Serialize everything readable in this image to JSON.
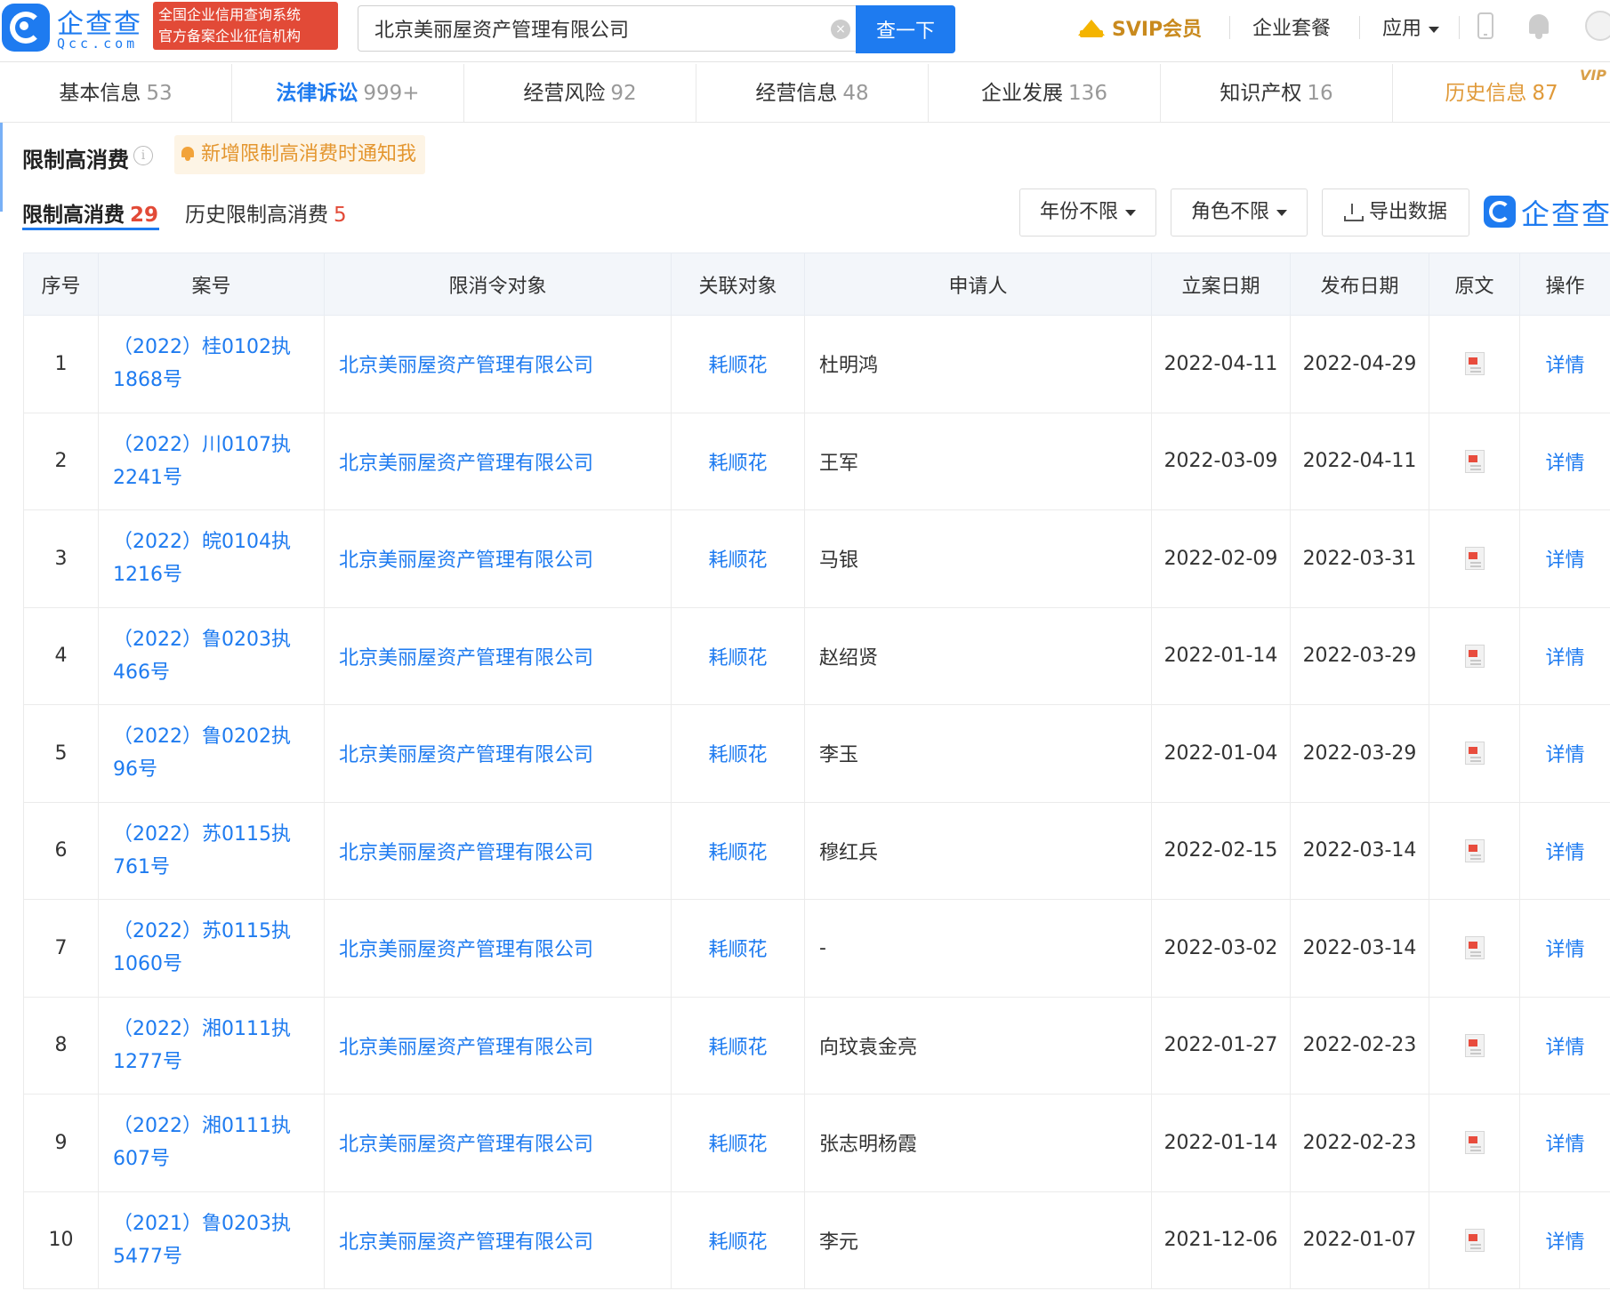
{
  "header": {
    "logo_cn": "企查查",
    "logo_en": "Qcc.com",
    "badge_line1": "全国企业信用查询系统",
    "badge_line2": "官方备案企业征信机构",
    "search_value": "北京美丽屋资产管理有限公司",
    "search_button": "查一下",
    "vip_label": "SVIP会员",
    "nav_package": "企业套餐",
    "nav_apps": "应用"
  },
  "tabs": [
    {
      "label": "基本信息",
      "count": "53"
    },
    {
      "label": "法律诉讼",
      "count": "999+"
    },
    {
      "label": "经营风险",
      "count": "92"
    },
    {
      "label": "经营信息",
      "count": "48"
    },
    {
      "label": "企业发展",
      "count": "136"
    },
    {
      "label": "知识产权",
      "count": "16"
    },
    {
      "label": "历史信息",
      "count": "87",
      "tag": "VIP"
    }
  ],
  "section": {
    "title": "限制高消费",
    "info_glyph": "i",
    "notify": "新增限制高消费时通知我",
    "subtab_active_label": "限制高消费",
    "subtab_active_count": "29",
    "subtab_history_label": "历史限制高消费",
    "subtab_history_count": "5",
    "filter_year": "年份不限",
    "filter_role": "角色不限",
    "export": "导出数据",
    "brand": "企查查"
  },
  "table": {
    "headers": [
      "序号",
      "案号",
      "限消令对象",
      "关联对象",
      "申请人",
      "立案日期",
      "发布日期",
      "原文",
      "操作"
    ],
    "rows": [
      {
        "no": "1",
        "case": "（2022）桂0102执1868号",
        "target": "北京美丽屋资产管理有限公司",
        "related": "耗顺花",
        "applicant": "杜明鸿",
        "filed": "2022-04-11",
        "published": "2022-04-29",
        "action": "详情"
      },
      {
        "no": "2",
        "case": "（2022）川0107执2241号",
        "target": "北京美丽屋资产管理有限公司",
        "related": "耗顺花",
        "applicant": "王军",
        "filed": "2022-03-09",
        "published": "2022-04-11",
        "action": "详情"
      },
      {
        "no": "3",
        "case": "（2022）皖0104执1216号",
        "target": "北京美丽屋资产管理有限公司",
        "related": "耗顺花",
        "applicant": "马银",
        "filed": "2022-02-09",
        "published": "2022-03-31",
        "action": "详情"
      },
      {
        "no": "4",
        "case": "（2022）鲁0203执466号",
        "target": "北京美丽屋资产管理有限公司",
        "related": "耗顺花",
        "applicant": "赵绍贤",
        "filed": "2022-01-14",
        "published": "2022-03-29",
        "action": "详情"
      },
      {
        "no": "5",
        "case": "（2022）鲁0202执96号",
        "target": "北京美丽屋资产管理有限公司",
        "related": "耗顺花",
        "applicant": "李玉",
        "filed": "2022-01-04",
        "published": "2022-03-29",
        "action": "详情"
      },
      {
        "no": "6",
        "case": "（2022）苏0115执761号",
        "target": "北京美丽屋资产管理有限公司",
        "related": "耗顺花",
        "applicant": "穆红兵",
        "filed": "2022-02-15",
        "published": "2022-03-14",
        "action": "详情"
      },
      {
        "no": "7",
        "case": "（2022）苏0115执1060号",
        "target": "北京美丽屋资产管理有限公司",
        "related": "耗顺花",
        "applicant": "-",
        "filed": "2022-03-02",
        "published": "2022-03-14",
        "action": "详情"
      },
      {
        "no": "8",
        "case": "（2022）湘0111执1277号",
        "target": "北京美丽屋资产管理有限公司",
        "related": "耗顺花",
        "applicant": "向玟袁金亮",
        "filed": "2022-01-27",
        "published": "2022-02-23",
        "action": "详情"
      },
      {
        "no": "9",
        "case": "（2022）湘0111执607号",
        "target": "北京美丽屋资产管理有限公司",
        "related": "耗顺花",
        "applicant": "张志明杨霞",
        "filed": "2022-01-14",
        "published": "2022-02-23",
        "action": "详情"
      },
      {
        "no": "10",
        "case": "（2021）鲁0203执5477号",
        "target": "北京美丽屋资产管理有限公司",
        "related": "耗顺花",
        "applicant": "李元",
        "filed": "2021-12-06",
        "published": "2022-01-07",
        "action": "详情"
      }
    ]
  },
  "icons": {
    "logo": "qcc-logo-icon",
    "clear": "clear-icon",
    "crown": "crown-icon",
    "phone": "phone-icon",
    "bell": "bell-icon",
    "info": "info-icon",
    "download": "download-icon",
    "pdf": "pdf-icon"
  },
  "colors": {
    "brand_blue": "#1e7bf0",
    "badge_red": "#e24a37",
    "vip_gold": "#c98a1e",
    "notify_orange": "#e4962f"
  }
}
